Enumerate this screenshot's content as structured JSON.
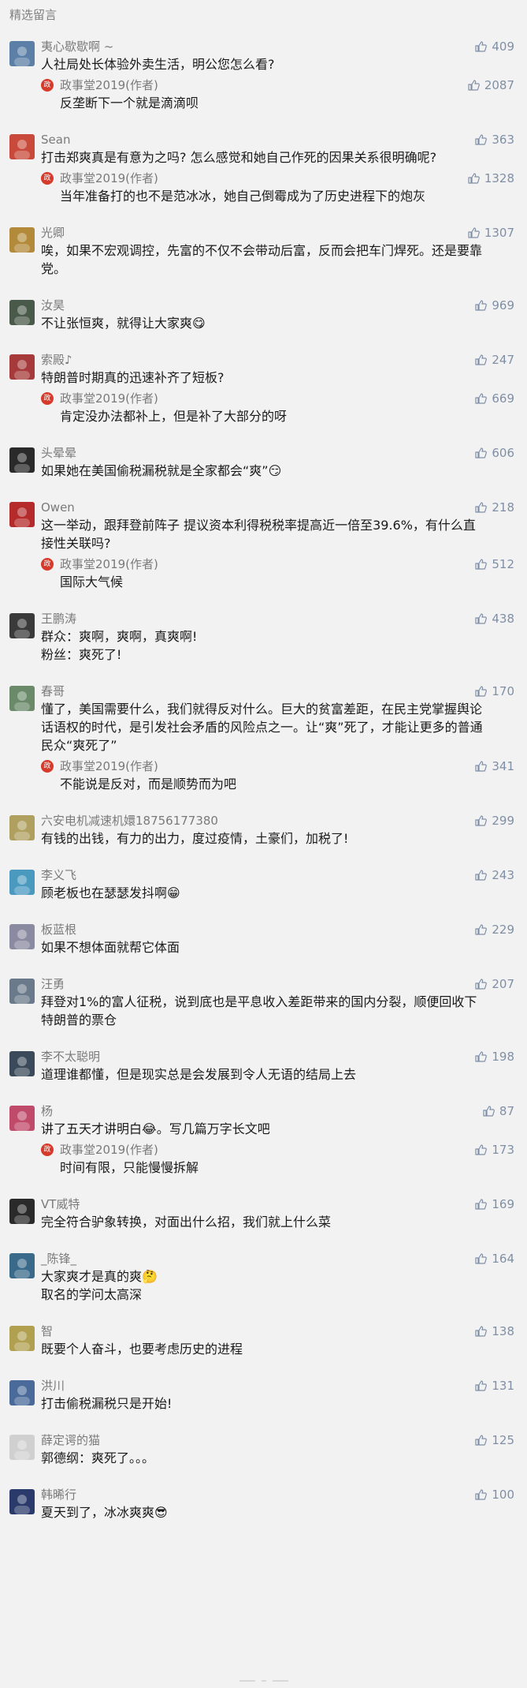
{
  "header": {
    "title": "精选留言"
  },
  "author_badge": "政",
  "comments": [
    {
      "nick": "夷心歇歇啊 ~",
      "likes": "409",
      "text": "人社局处长体验外卖生活，明公您怎么看?",
      "color": "#5b7fa6",
      "reply": {
        "nick": "政事堂2019(作者)",
        "likes": "2087",
        "text": "反垄断下一个就是滴滴呗"
      }
    },
    {
      "nick": "Sean",
      "likes": "363",
      "text": "打击郑爽真是有意为之吗? 怎么感觉和她自己作死的因果关系很明确呢?",
      "color": "#c94a3a",
      "reply": {
        "nick": "政事堂2019(作者)",
        "likes": "1328",
        "text": "当年准备打的也不是范冰冰，她自己倒霉成为了历史进程下的炮灰"
      }
    },
    {
      "nick": "光卿",
      "likes": "1307",
      "text": "唉，如果不宏观调控，先富的不仅不会带动后富，反而会把车门焊死。还是要靠党。",
      "color": "#b38a3a"
    },
    {
      "nick": "汝昊",
      "likes": "969",
      "text": "不让张恒爽，就得让大家爽😋",
      "color": "#4a5a4a"
    },
    {
      "nick": "索殿♪",
      "likes": "247",
      "text": "特朗普时期真的迅速补齐了短板?",
      "color": "#a63a3a",
      "reply": {
        "nick": "政事堂2019(作者)",
        "likes": "669",
        "text": "肯定没办法都补上，但是补了大部分的呀"
      }
    },
    {
      "nick": "头晕晕",
      "likes": "606",
      "text": "如果她在美国偷税漏税就是全家都会“爽”😏",
      "color": "#2a2a2a"
    },
    {
      "nick": "Owen",
      "likes": "218",
      "text": "这一举动，跟拜登前阵子 提议资本利得税税率提高近一倍至39.6%，有什么直接性关联吗?",
      "color": "#b52a2a",
      "reply": {
        "nick": "政事堂2019(作者)",
        "likes": "512",
        "text": "国际大气候"
      }
    },
    {
      "nick": "王鹏涛",
      "likes": "438",
      "text": "群众：爽啊，爽啊，真爽啊!\n粉丝：爽死了!",
      "color": "#3a3a3a"
    },
    {
      "nick": "春哥",
      "likes": "170",
      "text": "懂了，美国需要什么，我们就得反对什么。巨大的贫富差距，在民主党掌握舆论话语权的时代，是引发社会矛盾的风险点之一。让“爽”死了，才能让更多的普通民众“爽死了”",
      "color": "#6a8a6a",
      "reply": {
        "nick": "政事堂2019(作者)",
        "likes": "341",
        "text": "不能说是反对，而是顺势而为吧"
      }
    },
    {
      "nick": "六安电机减速机嬛18756177380",
      "likes": "299",
      "text": "有钱的出钱，有力的出力，度过疫情，土豪们，加税了!",
      "color": "#b0a060"
    },
    {
      "nick": "李义飞",
      "likes": "243",
      "text": "顾老板也在瑟瑟发抖啊😁",
      "color": "#4a9ac0"
    },
    {
      "nick": "板蓝根",
      "likes": "229",
      "text": "如果不想体面就帮它体面",
      "color": "#8a8aa0"
    },
    {
      "nick": "汪勇",
      "likes": "207",
      "text": "拜登对1%的富人征税，说到底也是平息收入差距带来的国内分裂，顺便回收下特朗普的票仓",
      "color": "#6a7a8a"
    },
    {
      "nick": "李不太聪明",
      "likes": "198",
      "text": "道理谁都懂，但是现实总是会发展到令人无语的结局上去",
      "color": "#3a4a5a"
    },
    {
      "nick": "杨",
      "likes": "87",
      "text": "讲了五天才讲明白😂。写几篇万字长文吧",
      "color": "#c04a6a",
      "reply": {
        "nick": "政事堂2019(作者)",
        "likes": "173",
        "text": "时间有限，只能慢慢拆解"
      }
    },
    {
      "nick": "VT威特",
      "likes": "169",
      "text": "完全符合驴象转换，对面出什么招，我们就上什么菜",
      "color": "#2a2a2a"
    },
    {
      "nick": "_陈锋_",
      "likes": "164",
      "text": "大家爽才是真的爽🤔\n取名的学问太高深",
      "color": "#3a6a8a"
    },
    {
      "nick": "智",
      "likes": "138",
      "text": "既要个人奋斗，也要考虑历史的进程",
      "color": "#b0a050"
    },
    {
      "nick": "洪川",
      "likes": "131",
      "text": "打击偷税漏税只是开始!",
      "color": "#4a6a9a"
    },
    {
      "nick": "薛定谔的猫",
      "likes": "125",
      "text": "郭德纲：爽死了。。。",
      "color": "#d0d0d0"
    },
    {
      "nick": "韩晞行",
      "likes": "100",
      "text": "夏天到了，冰冰爽爽😎",
      "color": "#2a3a6a"
    }
  ],
  "colors": {
    "like": "#7f8fa6",
    "nick": "#7a7a7a",
    "badge": "#d63a2b"
  }
}
